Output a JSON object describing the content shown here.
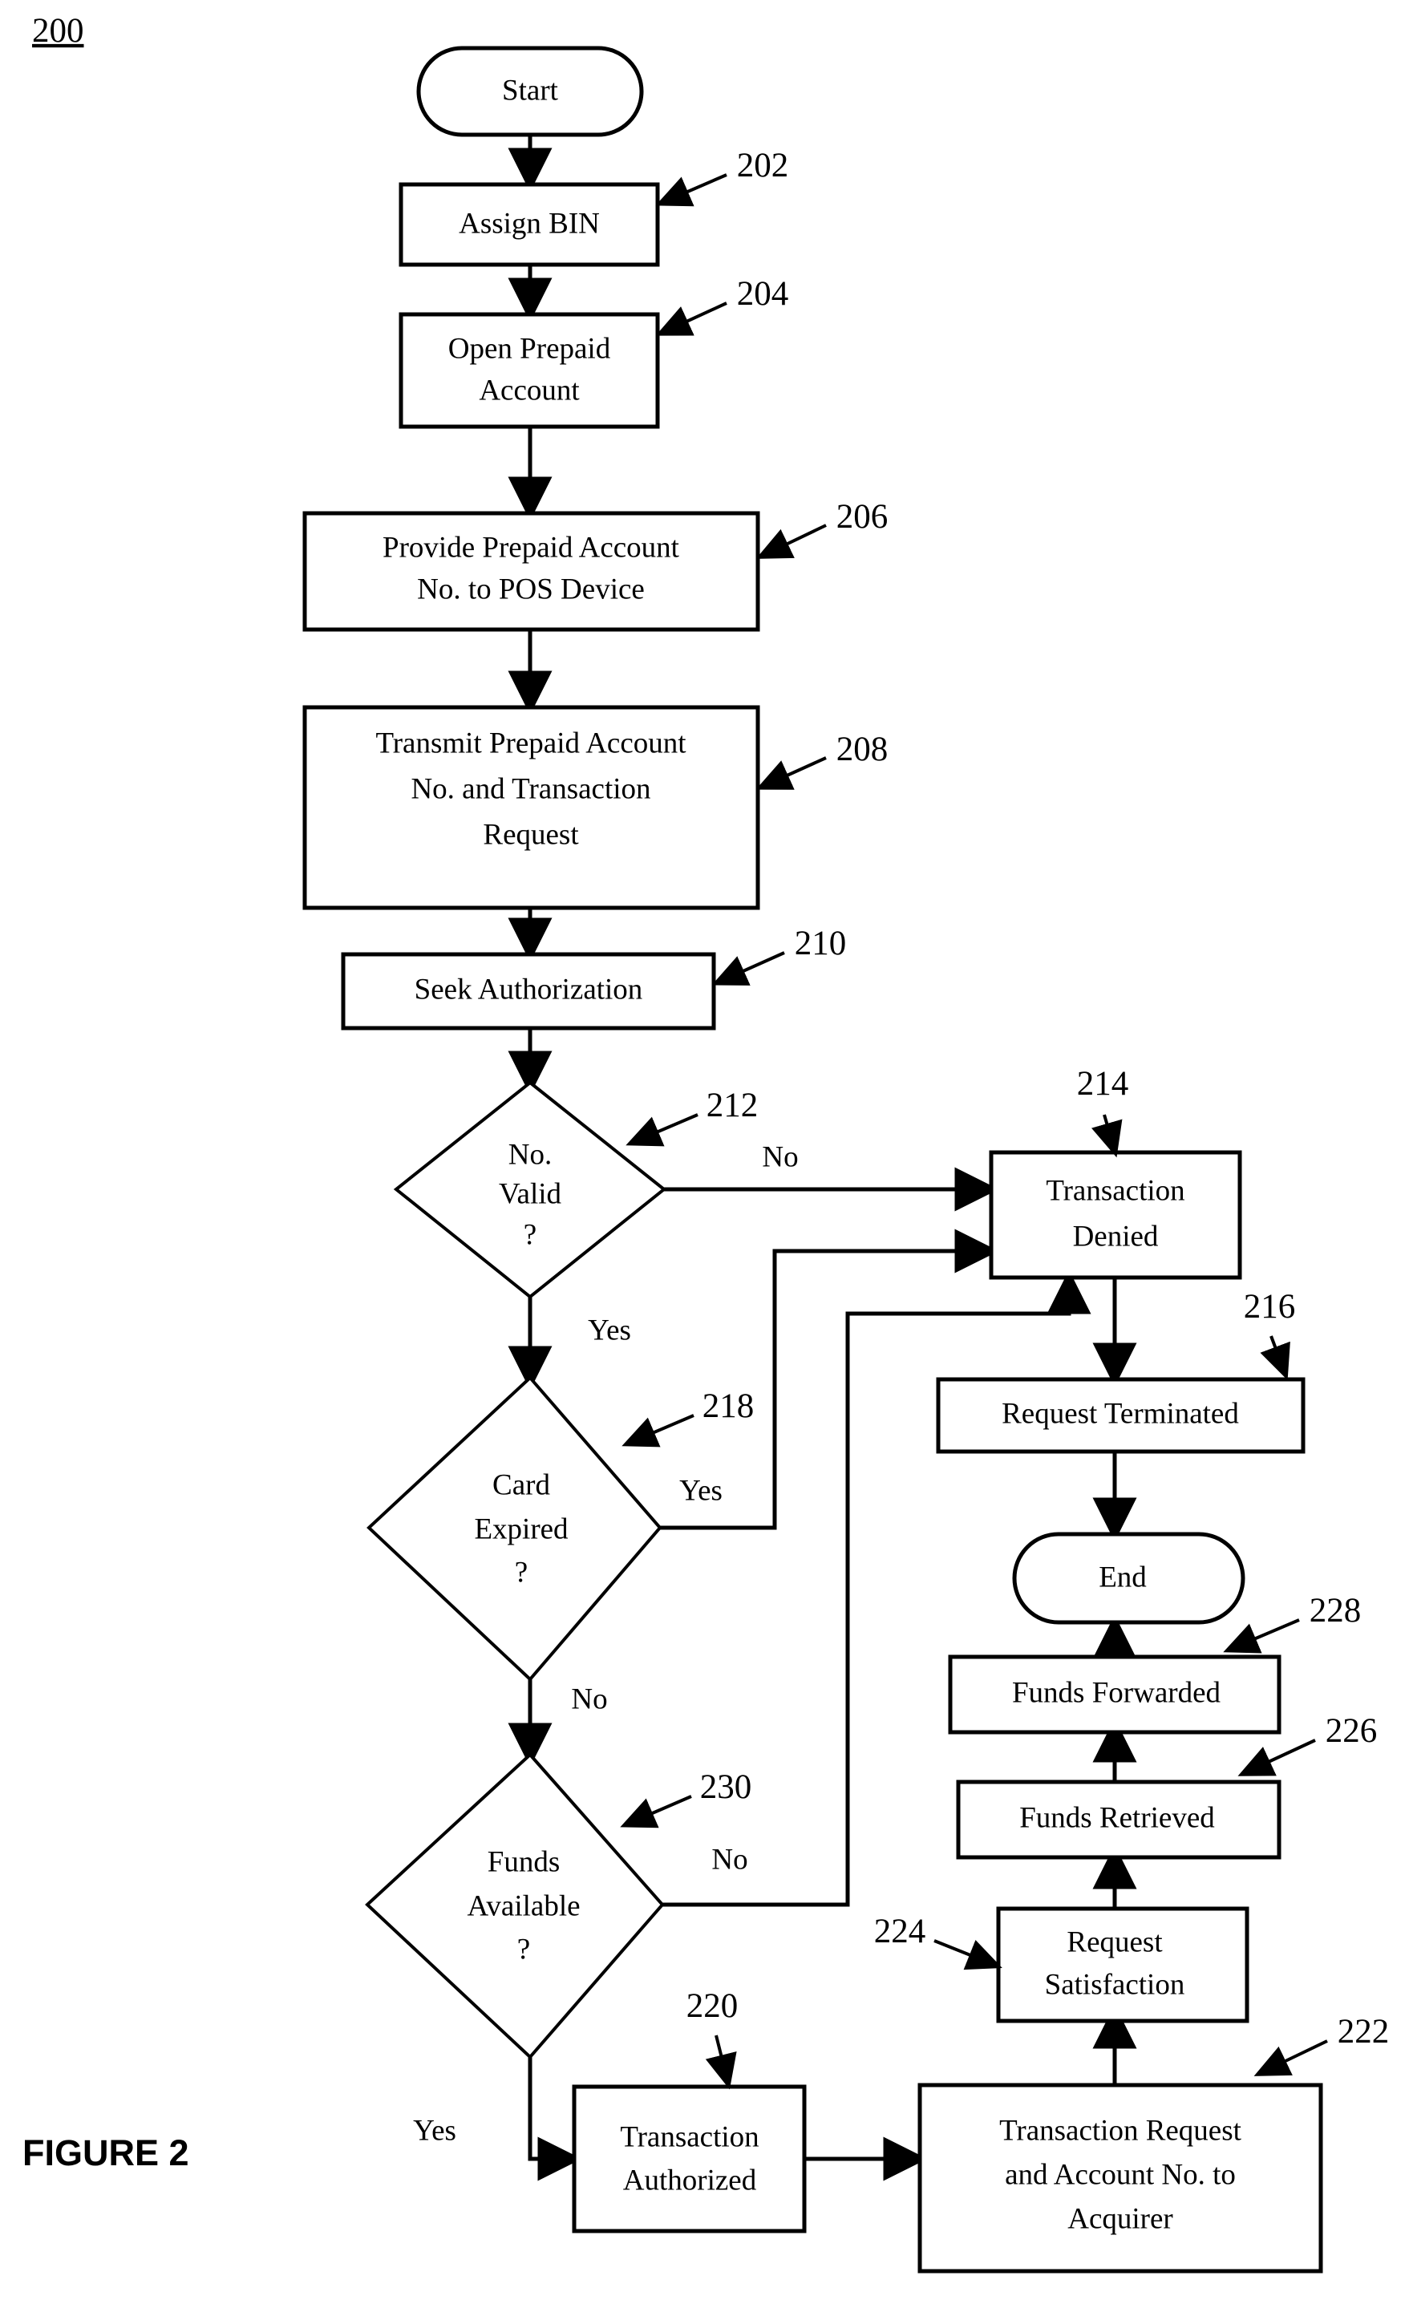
{
  "figure": {
    "number_label": "200",
    "caption": "FIGURE 2"
  },
  "nodes": {
    "start": {
      "label": "Start",
      "shape": "terminator"
    },
    "assign_bin": {
      "label": "Assign BIN",
      "ref": "202",
      "shape": "process"
    },
    "open_prepaid_account": {
      "line1": "Open Prepaid",
      "line2": "Account",
      "ref": "204",
      "shape": "process"
    },
    "provide_prepaid_account": {
      "line1": "Provide Prepaid Account",
      "line2": "No. to POS Device",
      "ref": "206",
      "shape": "process"
    },
    "transmit_prepaid_account": {
      "line1": "Transmit Prepaid Account",
      "line2": "No. and Transaction",
      "line3": "Request",
      "ref": "208",
      "shape": "process"
    },
    "seek_authorization": {
      "label": "Seek Authorization",
      "ref": "210",
      "shape": "process"
    },
    "no_valid": {
      "line1": "No.",
      "line2": "Valid",
      "line3": "?",
      "ref": "212",
      "shape": "decision"
    },
    "transaction_denied": {
      "line1": "Transaction",
      "line2": "Denied",
      "ref": "214",
      "shape": "process"
    },
    "request_terminated": {
      "label": "Request Terminated",
      "ref": "216",
      "shape": "process"
    },
    "card_expired": {
      "line1": "Card",
      "line2": "Expired",
      "line3": "?",
      "ref": "218",
      "shape": "decision"
    },
    "end": {
      "label": "End",
      "shape": "terminator"
    },
    "funds_forwarded": {
      "label": "Funds Forwarded",
      "ref": "228",
      "shape": "process"
    },
    "funds_retrieved": {
      "label": "Funds Retrieved",
      "ref": "226",
      "shape": "process"
    },
    "request_satisfaction": {
      "line1": "Request",
      "line2": "Satisfaction",
      "ref": "224",
      "shape": "process"
    },
    "funds_available": {
      "line1": "Funds",
      "line2": "Available",
      "line3": "?",
      "ref": "230",
      "shape": "decision"
    },
    "transaction_authorized": {
      "line1": "Transaction",
      "line2": "Authorized",
      "ref": "220",
      "shape": "process"
    },
    "transaction_request_acquirer": {
      "line1": "Transaction Request",
      "line2": "and Account No. to",
      "line3": "Acquirer",
      "ref": "222",
      "shape": "process"
    }
  },
  "edge_labels": {
    "no_valid_no": "No",
    "no_valid_yes": "Yes",
    "card_expired_yes": "Yes",
    "card_expired_no": "No",
    "funds_available_no": "No",
    "funds_available_yes": "Yes"
  },
  "colors": {
    "stroke": "#000000",
    "fill": "#ffffff"
  }
}
